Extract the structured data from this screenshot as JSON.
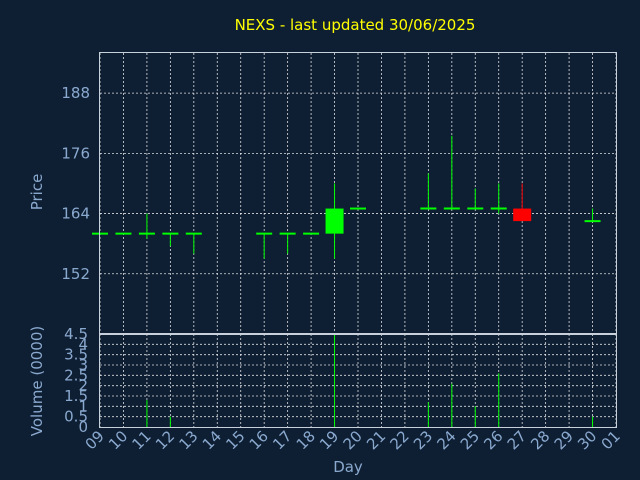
{
  "chart_data": {
    "type": "candlestick",
    "title": "NEXS - last updated 30/06/2025",
    "ylabel": "Price",
    "volume_ylabel": "Volume (0000)",
    "xlabel": "Day",
    "x_ticks": [
      "09",
      "10",
      "11",
      "12",
      "13",
      "14",
      "15",
      "16",
      "17",
      "18",
      "19",
      "20",
      "21",
      "22",
      "23",
      "24",
      "25",
      "26",
      "27",
      "28",
      "29",
      "30",
      "01"
    ],
    "y_ticks": [
      152,
      164,
      176,
      188
    ],
    "ylim": [
      140,
      196
    ],
    "volume_ticks": [
      "0",
      "0.5",
      "1",
      "1.5",
      "2",
      "2.5",
      "3",
      "3.5",
      "4",
      "4.5"
    ],
    "volume_ylim": [
      0,
      4.5
    ],
    "grid": true,
    "up_color": "#00ff00",
    "down_color": "#ff0000",
    "candles": [
      {
        "day": "09",
        "open": 160,
        "high": 160,
        "low": 160,
        "close": 160,
        "volume": 0
      },
      {
        "day": "10",
        "open": 160,
        "high": 160,
        "low": 160,
        "close": 160,
        "volume": 0
      },
      {
        "day": "11",
        "open": 160,
        "high": 164,
        "low": 159,
        "close": 160,
        "volume": 1.3
      },
      {
        "day": "12",
        "open": 160,
        "high": 160,
        "low": 157.5,
        "close": 160,
        "volume": 0.5
      },
      {
        "day": "13",
        "open": 160,
        "high": 160,
        "low": 156,
        "close": 160,
        "volume": 0
      },
      {
        "day": "16",
        "open": 160,
        "high": 160,
        "low": 155,
        "close": 160,
        "volume": 0
      },
      {
        "day": "17",
        "open": 160,
        "high": 160,
        "low": 156,
        "close": 160,
        "volume": 0
      },
      {
        "day": "18",
        "open": 160,
        "high": 160,
        "low": 160,
        "close": 160,
        "volume": 0
      },
      {
        "day": "19",
        "open": 160,
        "high": 170,
        "low": 155,
        "close": 165,
        "volume": 4.5
      },
      {
        "day": "20",
        "open": 165,
        "high": 165,
        "low": 165,
        "close": 165,
        "volume": 0
      },
      {
        "day": "23",
        "open": 165,
        "high": 172,
        "low": 165,
        "close": 165,
        "volume": 1.2
      },
      {
        "day": "24",
        "open": 165,
        "high": 179.5,
        "low": 165,
        "close": 165,
        "volume": 2.1
      },
      {
        "day": "25",
        "open": 165,
        "high": 169,
        "low": 165,
        "close": 165,
        "volume": 1.0
      },
      {
        "day": "26",
        "open": 165,
        "high": 170,
        "low": 164,
        "close": 165,
        "volume": 2.6
      },
      {
        "day": "27",
        "open": 165,
        "high": 170,
        "low": 162.5,
        "close": 162.5,
        "volume": 0
      },
      {
        "day": "30",
        "open": 162.5,
        "high": 165,
        "low": 162.5,
        "close": 162.5,
        "volume": 0.5
      }
    ]
  }
}
